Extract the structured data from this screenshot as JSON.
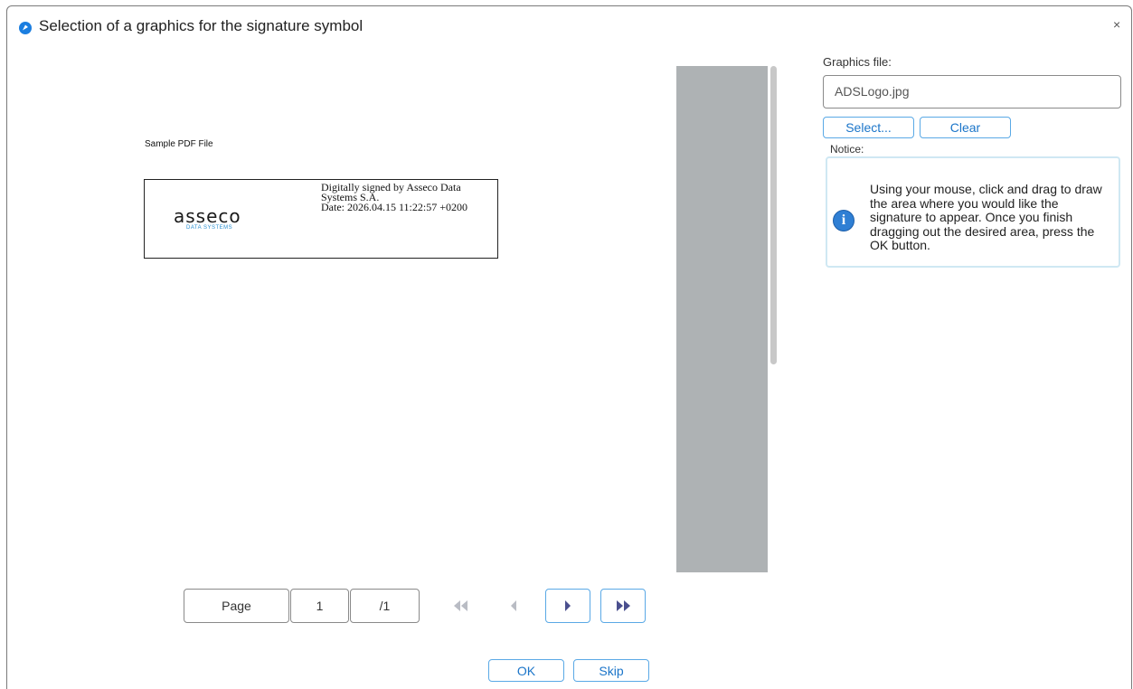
{
  "window": {
    "title": "Selection of a graphics for the signature symbol",
    "close_glyph": "×"
  },
  "document": {
    "heading": "Sample PDF File",
    "signature": {
      "logo_main": "asseco",
      "logo_sub": "DATA SYSTEMS",
      "line1": "Digitally signed by Asseco Data",
      "line2": "Systems S.A.",
      "line3": "Date: 2026.04.15 11:22:57 +0200"
    }
  },
  "pager": {
    "page_label": "Page",
    "current_page": "1",
    "total_pages": "/1",
    "icons": [
      "first-page-icon",
      "previous-page-icon",
      "next-page-icon",
      "last-page-icon"
    ]
  },
  "side": {
    "graphics_file_label": "Graphics file:",
    "graphics_file_value": "ADSLogo.jpg",
    "select_label": "Select...",
    "clear_label": "Clear",
    "notice_label": "Notice:",
    "notice_text": "Using your mouse, click and drag to draw the area where you would like the signature to appear. Once you finish dragging out the desired area, press the OK button."
  },
  "footer": {
    "ok_label": "OK",
    "skip_label": "Skip"
  },
  "colors": {
    "accent": "#1b75c9",
    "button_border": "#5aa9e6",
    "gray_strip": "#aeb2b4",
    "notice_border": "#cfe8f3",
    "disabled_nav": "#b9bcc4",
    "active_nav": "#4a4f8e"
  }
}
